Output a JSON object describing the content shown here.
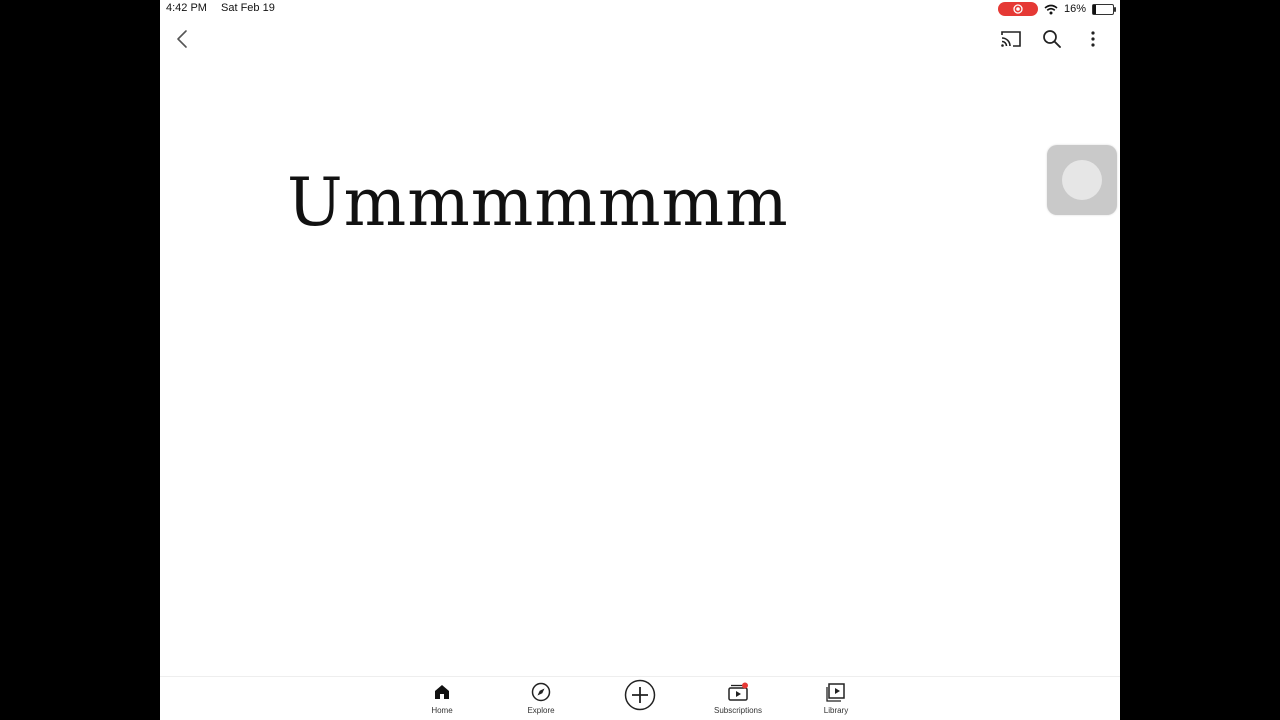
{
  "status_bar": {
    "time": "4:42 PM",
    "date": "Sat Feb 19",
    "battery_percent": "16%",
    "battery_level": 0.16
  },
  "icons": {
    "back": "chevron-left-icon",
    "cast": "cast-icon",
    "search": "search-icon",
    "more": "more-vertical-icon",
    "home": "home-icon",
    "explore": "compass-icon",
    "create": "plus-circle-icon",
    "subscriptions": "subscriptions-icon",
    "library": "library-icon"
  },
  "content": {
    "big_text": "Ummmmmmm"
  },
  "bottom_nav": {
    "items": [
      {
        "label": "Home"
      },
      {
        "label": "Explore"
      },
      {
        "label": ""
      },
      {
        "label": "Subscriptions"
      },
      {
        "label": "Library"
      }
    ]
  },
  "colors": {
    "record_indicator": "#e53935",
    "notification_dot": "#e53935",
    "background": "#ffffff",
    "letterbox": "#000000"
  }
}
